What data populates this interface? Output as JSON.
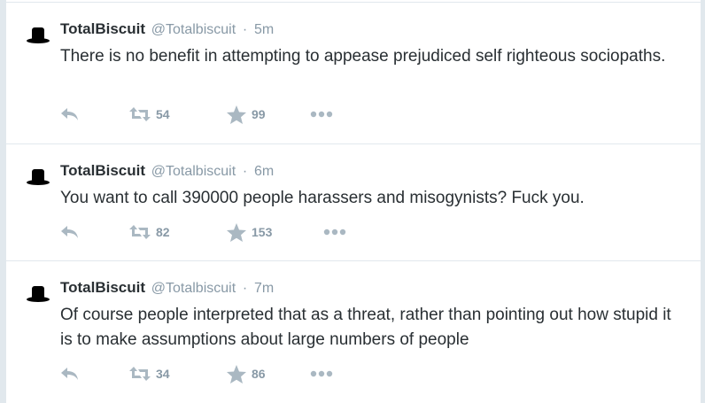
{
  "tweets": [
    {
      "name": "TotalBiscuit",
      "handle": "@Totalbiscuit",
      "separator": "·",
      "time": "5m",
      "text": "There is no benefit in attempting to appease prejudiced self righteous sociopaths.",
      "retweets": "54",
      "favorites": "99"
    },
    {
      "name": "TotalBiscuit",
      "handle": "@Totalbiscuit",
      "separator": "·",
      "time": "6m",
      "text": "You want to call 390000 people harassers and misogynists? Fuck you.",
      "retweets": "82",
      "favorites": "153"
    },
    {
      "name": "TotalBiscuit",
      "handle": "@Totalbiscuit",
      "separator": "·",
      "time": "7m",
      "text": "Of course people interpreted that as a threat, rather than pointing out how stupid it is to make assumptions about large numbers of people",
      "retweets": "34",
      "favorites": "86"
    }
  ],
  "icons": {
    "avatar": "top-hat-icon",
    "reply": "reply-icon",
    "retweet": "retweet-icon",
    "favorite": "star-icon",
    "more": "more-icon"
  },
  "colors": {
    "text": "#292f33",
    "muted": "#8899a6",
    "icon": "#aab8c2",
    "border": "#e1e8ed"
  }
}
